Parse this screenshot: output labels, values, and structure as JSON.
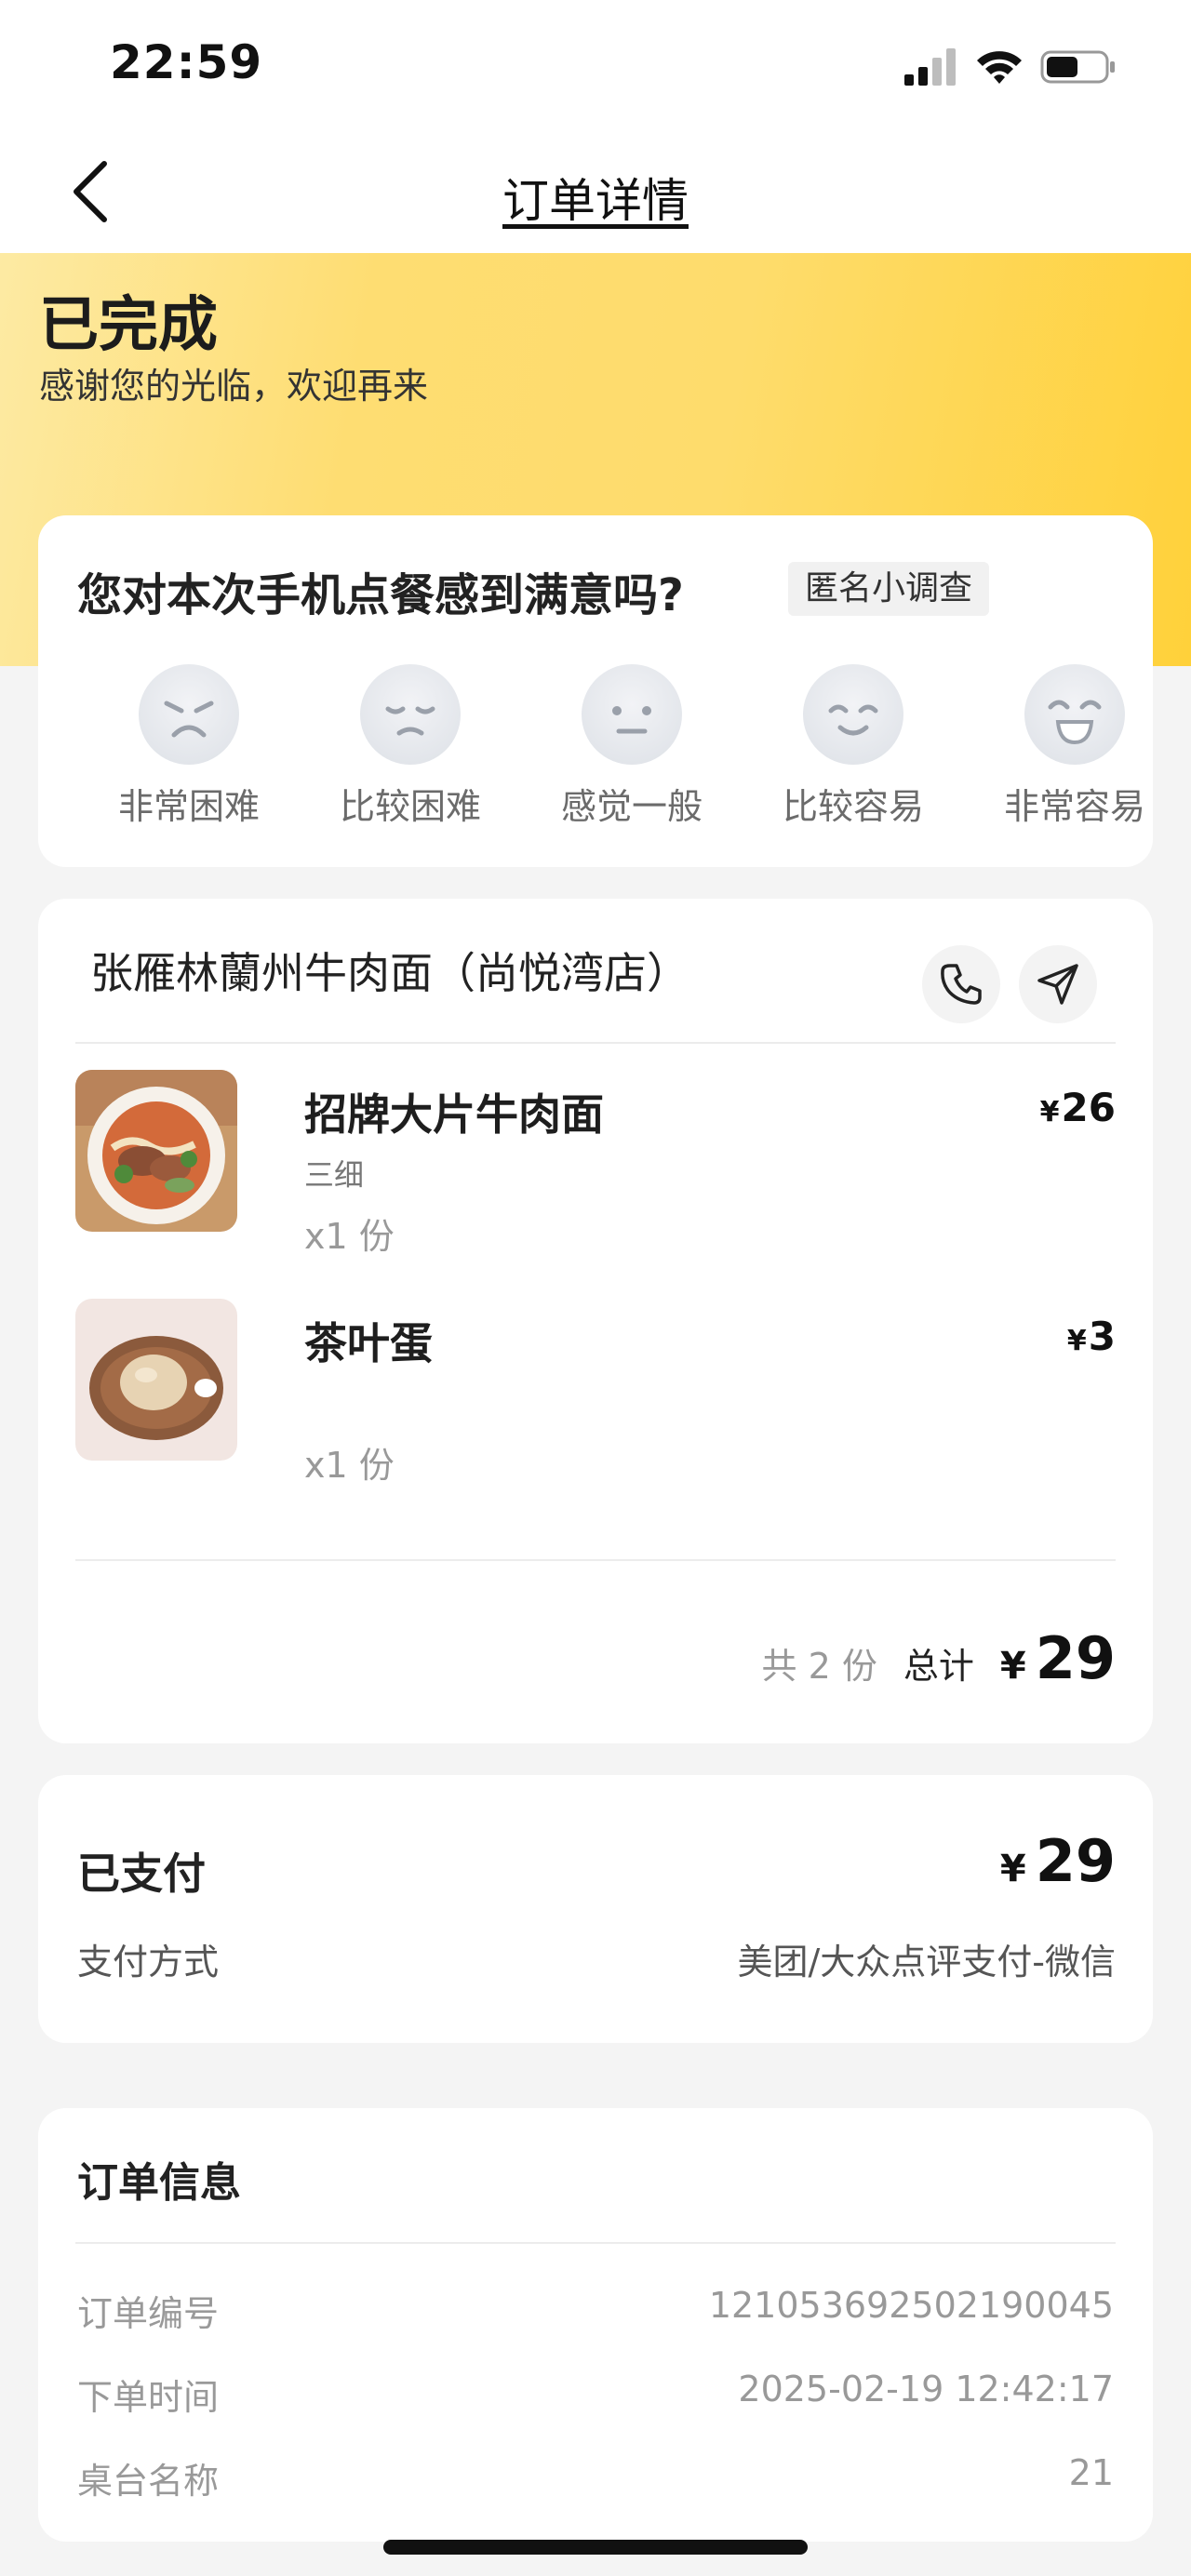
{
  "status": {
    "time": "22:59",
    "battery_level": 0.55
  },
  "nav": {
    "title": "订单详情",
    "back_icon": "chevron-left-icon"
  },
  "hero": {
    "status": "已完成",
    "message": "感谢您的光临，欢迎再来"
  },
  "survey": {
    "question": "您对本次手机点餐感到满意吗?",
    "badge": "匿名小调查",
    "options": [
      {
        "label": "非常困难",
        "icon": "very-sad-face-icon"
      },
      {
        "label": "比较困难",
        "icon": "sad-face-icon"
      },
      {
        "label": "感觉一般",
        "icon": "neutral-face-icon"
      },
      {
        "label": "比较容易",
        "icon": "smile-face-icon"
      },
      {
        "label": "非常容易",
        "icon": "very-happy-face-icon"
      }
    ]
  },
  "order": {
    "shop": "张雁林蘭州牛肉面（尚悦湾店）",
    "items": [
      {
        "name": "招牌大片牛肉面",
        "spec": "三细",
        "qty": "x1 份",
        "currency": "¥",
        "price": "26"
      },
      {
        "name": "茶叶蛋",
        "spec": "",
        "qty": "x1 份",
        "currency": "¥",
        "price": "3"
      }
    ],
    "count_text": "共 2 份",
    "total_label": "总计",
    "currency": "¥",
    "total": "29"
  },
  "payment": {
    "status": "已支付",
    "currency": "¥",
    "amount": "29",
    "method_label": "支付方式",
    "method": "美团/大众点评支付-微信"
  },
  "info": {
    "title": "订单信息",
    "rows": [
      {
        "label": "订单编号",
        "value": "121053692502190045"
      },
      {
        "label": "下单时间",
        "value": "2025-02-19 12:42:17"
      },
      {
        "label": "桌台名称",
        "value": "21"
      }
    ]
  },
  "colors": {
    "hero_yellow": "#fedc6c",
    "hero_yellow_end": "#ffd13a",
    "background": "#f4f4f4"
  }
}
